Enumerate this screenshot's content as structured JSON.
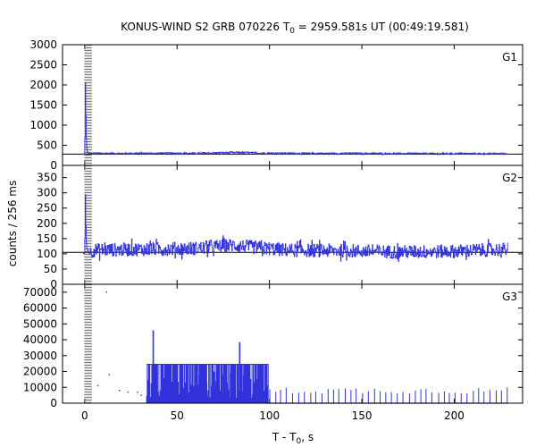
{
  "figure": {
    "title_prefix": "KONUS-WIND S2 GRB 070226 T",
    "title_sub": "0",
    "title_suffix": " = 2959.581s UT (00:49:19.581)",
    "xlabel_prefix": "T - T",
    "xlabel_sub": "0",
    "xlabel_suffix": ", s",
    "ylabel": "counts / 256 ms"
  },
  "colors": {
    "series": "#3232dc",
    "axes": "#000000",
    "trigger_marker": "#808080"
  },
  "chart_data": [
    {
      "type": "line",
      "panel": "G1",
      "trigger_time": 0,
      "xlim": [
        -12,
        237
      ],
      "ylim": [
        0,
        3000
      ],
      "xticks": [
        0,
        50,
        100,
        150,
        200
      ],
      "yticks": [
        0,
        500,
        1000,
        1500,
        2000,
        2500,
        3000
      ],
      "background_level": 280,
      "background_extent": [
        -12,
        237
      ],
      "series": [
        {
          "points": [
            [
              -1,
              285
            ],
            [
              0,
              290
            ],
            [
              0.13,
              2420
            ],
            [
              0.38,
              1800
            ],
            [
              0.64,
              900
            ],
            [
              0.9,
              520
            ],
            [
              1.2,
              360
            ],
            [
              1.6,
              310
            ],
            [
              2.5,
              295
            ],
            [
              5,
              300
            ],
            [
              20,
              298
            ],
            [
              40,
              302
            ],
            [
              60,
              300
            ],
            [
              75,
              315
            ],
            [
              85,
              320
            ],
            [
              95,
              306
            ],
            [
              120,
              298
            ],
            [
              150,
              296
            ],
            [
              180,
              294
            ],
            [
              210,
              292
            ],
            [
              229,
              290
            ]
          ],
          "noise": 20
        }
      ]
    },
    {
      "type": "line",
      "panel": "G2",
      "trigger_time": 0,
      "xlim": [
        -12,
        237
      ],
      "ylim": [
        0,
        390
      ],
      "xticks": [
        0,
        50,
        100,
        150,
        200
      ],
      "yticks": [
        0,
        50,
        100,
        150,
        200,
        250,
        300,
        350
      ],
      "background_level": 105,
      "background_extent": [
        -12,
        237
      ],
      "series": [
        {
          "points": [
            [
              -1,
              100
            ],
            [
              0,
              102
            ],
            [
              0.13,
              375
            ],
            [
              0.38,
              240
            ],
            [
              0.64,
              160
            ],
            [
              0.9,
              120
            ],
            [
              1.5,
              112
            ],
            [
              2.5,
              100
            ],
            [
              5,
              112
            ],
            [
              30,
              115
            ],
            [
              60,
              118
            ],
            [
              80,
              128
            ],
            [
              90,
              122
            ],
            [
              110,
              112
            ],
            [
              140,
              110
            ],
            [
              170,
              106
            ],
            [
              200,
              108
            ],
            [
              215,
              112
            ],
            [
              229,
              115
            ]
          ],
          "noise": 22
        }
      ]
    },
    {
      "type": "line",
      "panel": "G3",
      "trigger_time": 0,
      "xlim": [
        -12,
        237
      ],
      "ylim": [
        0,
        75000
      ],
      "xticks": [
        0,
        50,
        100,
        150,
        200
      ],
      "yticks": [
        0,
        10000,
        20000,
        30000,
        40000,
        50000,
        60000,
        70000
      ],
      "background_level": 0,
      "series": [
        {
          "scattered_points": [
            [
              11.8,
              70000
            ],
            [
              7.1,
              11000
            ],
            [
              13.3,
              18000
            ],
            [
              18.8,
              8000
            ],
            [
              23.4,
              7000
            ],
            [
              28.7,
              7000
            ],
            [
              30.6,
              5000
            ]
          ],
          "dense_block": {
            "x_range": [
              33.5,
              99.5
            ],
            "level": 24500,
            "low_level": 3000,
            "gap_count": 30
          },
          "spikes": [
            [
              34.2,
              14000
            ],
            [
              37.1,
              46000
            ],
            [
              83.9,
              38500
            ],
            [
              45,
              17000
            ],
            [
              57,
              14500
            ],
            [
              62,
              16500
            ],
            [
              66,
              13500
            ],
            [
              70,
              20000
            ],
            [
              75,
              18000
            ],
            [
              79,
              19000
            ],
            [
              81,
              21000
            ],
            [
              86,
              17500
            ],
            [
              88,
              16000
            ],
            [
              92,
              14000
            ]
          ],
          "periodic_spikes": {
            "x_range": [
              100,
              229
            ],
            "count": 42,
            "level_range": [
              6000,
              10000
            ]
          }
        }
      ]
    }
  ]
}
